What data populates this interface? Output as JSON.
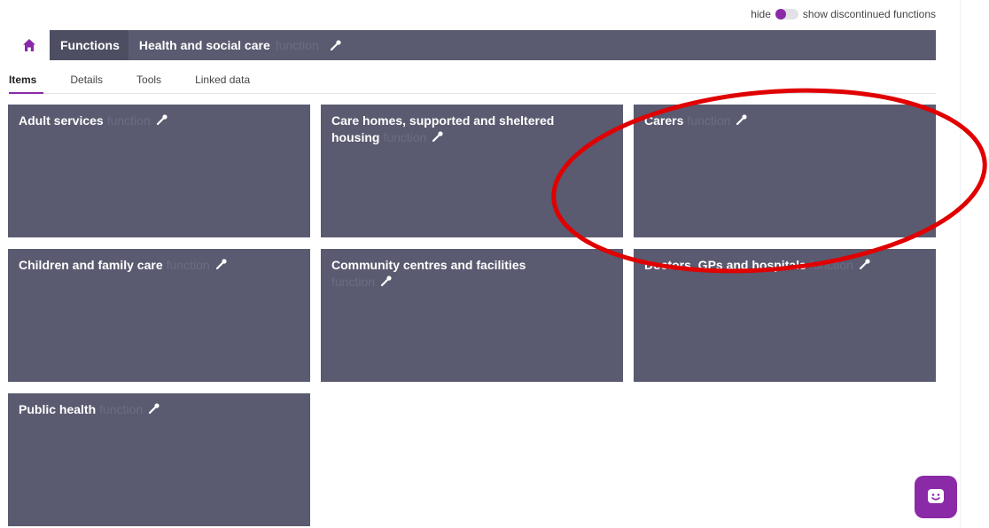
{
  "toggle": {
    "hide_label": "hide",
    "show_label": "show discontinued functions",
    "accent": "#8b2aa6"
  },
  "header": {
    "home_icon": "home-icon",
    "root_crumb": "Functions",
    "current_title": "Health and social care",
    "current_type": "function",
    "edit_icon": "wrench-icon"
  },
  "tabs": [
    {
      "label": "Items",
      "active": true
    },
    {
      "label": "Details",
      "active": false
    },
    {
      "label": "Tools",
      "active": false
    },
    {
      "label": "Linked data",
      "active": false
    }
  ],
  "cards": [
    {
      "title": "Adult services",
      "type": "function"
    },
    {
      "title": "Care homes, supported and sheltered housing",
      "type": "function"
    },
    {
      "title": "Carers",
      "type": "function"
    },
    {
      "title": "Children and family care",
      "type": "function"
    },
    {
      "title": "Community centres and facilities",
      "type": "function"
    },
    {
      "title": "Doctors, GPs and hospitals",
      "type": "function"
    },
    {
      "title": "Public health",
      "type": "function"
    }
  ],
  "chat": {
    "icon": "chat-smiley-icon"
  },
  "colors": {
    "card_bg": "#5a5a70",
    "type_text": "#6c6c87",
    "annotation": "#e00000"
  }
}
